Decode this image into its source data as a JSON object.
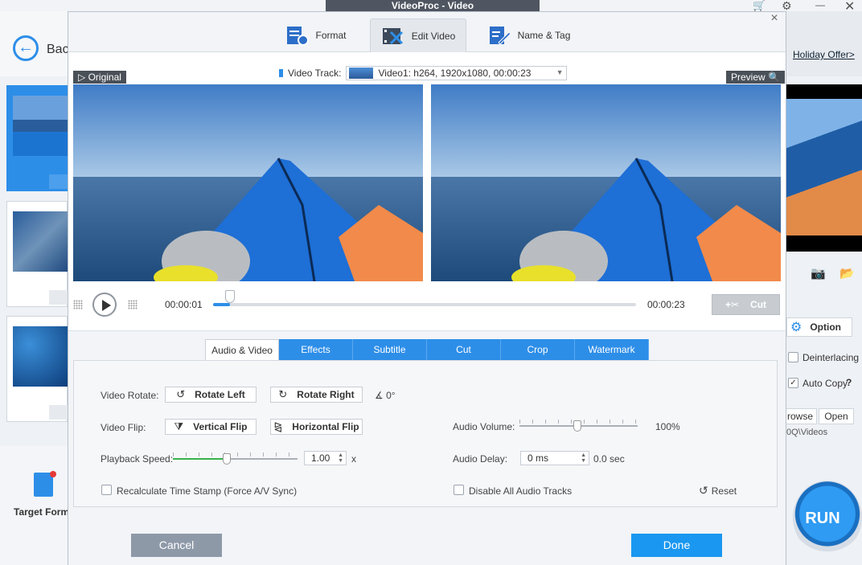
{
  "app": {
    "window_title": "VideoProc - Video",
    "back_label": "Bac",
    "holiday_offer": "Holiday Offer>",
    "target_format": "Target Form",
    "option_label": "Option",
    "deinterlacing": "Deinterlacing",
    "auto_copy": "Auto Copy",
    "auto_copy_help": "?",
    "browse": "rowse",
    "open": "Open",
    "path_fragment": "0Q\\Videos",
    "run_label": "RUN"
  },
  "dialog": {
    "tabs": [
      {
        "label": "Format",
        "icon": "format-icon"
      },
      {
        "label": "Edit Video",
        "icon": "edit-video-icon",
        "active": true
      },
      {
        "label": "Name & Tag",
        "icon": "name-tag-icon"
      }
    ],
    "close": "×",
    "video_track_label": "Video Track:",
    "video_track_value": "Video1: h264, 1920x1080, 00:00:23",
    "original_label": "Original",
    "preview_label": "Preview",
    "time_current": "00:00:01",
    "time_total": "00:00:23",
    "progress": 0.04,
    "cut_label": "Cut",
    "subtabs": [
      {
        "label": "Audio & Video",
        "active": true
      },
      {
        "label": "Effects"
      },
      {
        "label": "Subtitle"
      },
      {
        "label": "Cut"
      },
      {
        "label": "Crop"
      },
      {
        "label": "Watermark"
      }
    ],
    "video_rotate_label": "Video Rotate:",
    "rotate_left": "Rotate Left",
    "rotate_right": "Rotate Right",
    "rotate_angle": "0°",
    "video_flip_label": "Video Flip:",
    "vertical_flip": "Vertical Flip",
    "horizontal_flip": "Horizontal Flip",
    "playback_speed_label": "Playback Speed:",
    "playback_speed_value": "1.00",
    "playback_speed_unit": "x",
    "audio_volume_label": "Audio Volume:",
    "audio_volume_value": "100%",
    "audio_delay_label": "Audio Delay:",
    "audio_delay_value": "0 ms",
    "audio_delay_sec": "0.0 sec",
    "recalculate_label": "Recalculate Time Stamp (Force A/V Sync)",
    "disable_audio_label": "Disable All Audio Tracks",
    "reset_label": "Reset",
    "cancel_label": "Cancel",
    "done_label": "Done"
  },
  "colors": {
    "accent": "#2d8ee8",
    "done": "#1a97f0",
    "cancel": "#8e99a8"
  }
}
